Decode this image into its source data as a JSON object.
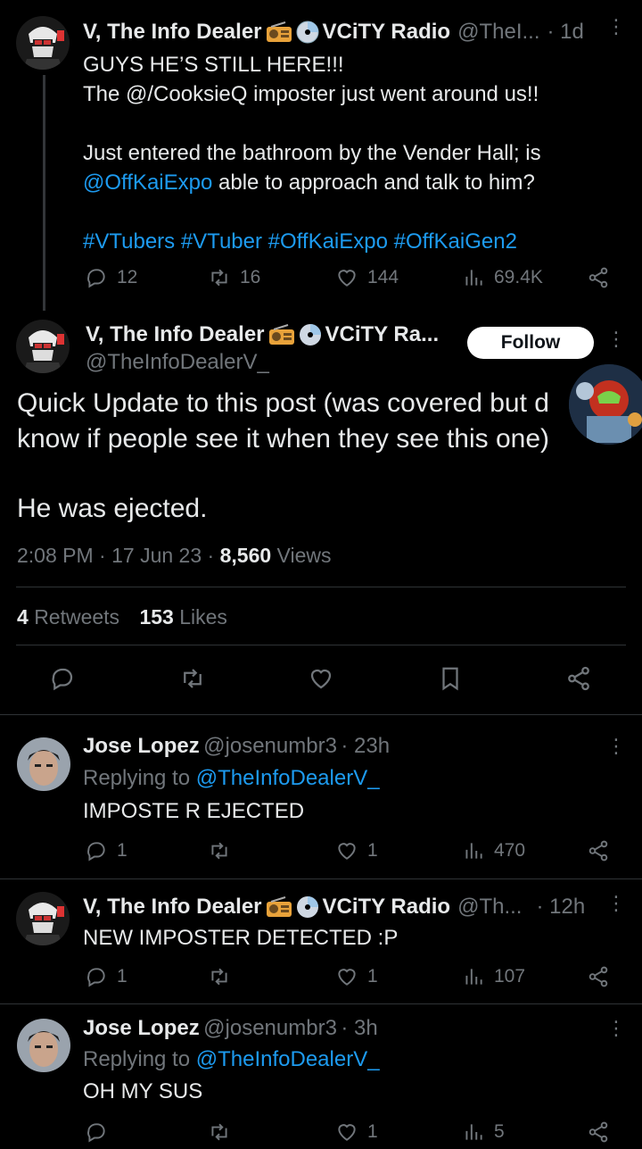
{
  "tweet1": {
    "author_name": "V, The Info Dealer",
    "author_suffix": "VCiTY Radio",
    "handle": "@TheI...",
    "time": "· 1d",
    "lines": [
      "GUYS HE’S STILL HERE!!!",
      "The @/CooksieQ imposter just went around us!!",
      "",
      "Just entered the bathroom by the Vender Hall; is",
      "@OffKaiExpo",
      " able to approach and talk to him?",
      "",
      "#VTubers #VTuber #OffKaiExpo #OffKaiGen2"
    ],
    "replies": "12",
    "retweets": "16",
    "likes": "144",
    "views": "69.4K"
  },
  "tweet2": {
    "author_name": "V, The Info Dealer",
    "author_suffix": "VCiTY Ra...",
    "handle": "@TheInfoDealerV_",
    "follow_label": "Follow",
    "text_line1": "Quick Update to this post (was covered but d",
    "text_line2": "know if people see it when they see this one)",
    "text_line3": "He was ejected.",
    "time": "2:08 PM",
    "date": "17 Jun 23",
    "views_count": "8,560",
    "views_label": "Views",
    "retweets_count": "4",
    "retweets_label": "Retweets",
    "likes_count": "153",
    "likes_label": "Likes"
  },
  "reply1": {
    "author_name": "Jose Lopez",
    "handle": "@josenumbr3",
    "time": "· 23h",
    "replying_prefix": "Replying to",
    "replying_to": "@TheInfoDealerV_",
    "text": "IMPOSTE R EJECTED",
    "replies": "1",
    "retweets": "",
    "likes": "1",
    "views": "470"
  },
  "reply2": {
    "author_name": "V, The Info Dealer",
    "author_suffix": "VCiTY Radio",
    "handle": "@Th...",
    "time": "· 12h",
    "text": "NEW IMPOSTER DETECTED :P",
    "replies": "1",
    "retweets": "",
    "likes": "1",
    "views": "107"
  },
  "reply3": {
    "author_name": "Jose Lopez",
    "handle": "@josenumbr3",
    "time": "· 3h",
    "replying_prefix": "Replying to",
    "replying_to": "@TheInfoDealerV_",
    "text": "OH MY SUS",
    "replies": "",
    "retweets": "",
    "likes": "1",
    "views": "5"
  },
  "colors": {
    "background": "#000000",
    "text": "#e7e9ea",
    "secondary": "#71767b",
    "link": "#1d9bf0",
    "divider": "#2f3336"
  }
}
